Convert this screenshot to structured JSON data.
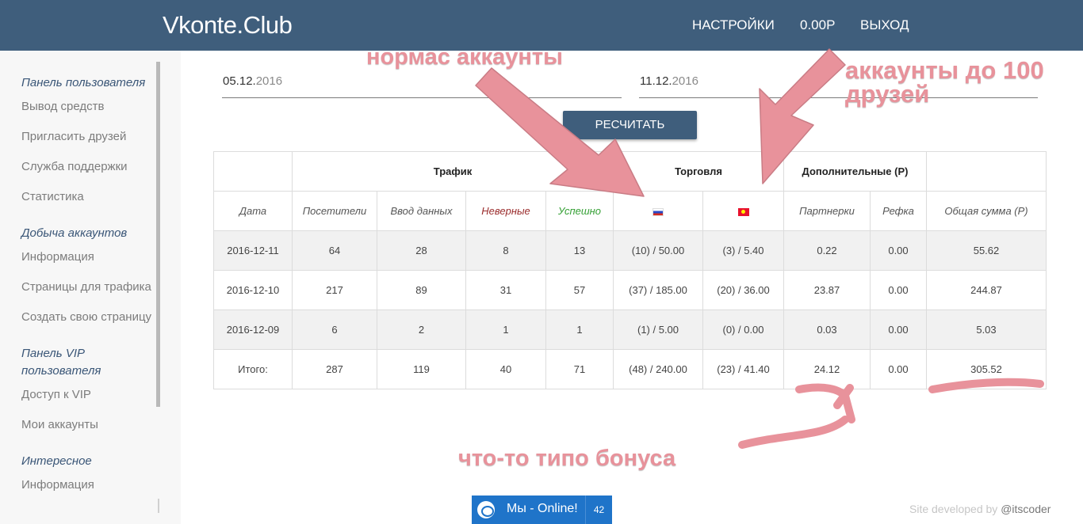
{
  "header": {
    "brand": "Vkonte.Club",
    "nav": {
      "settings": "НАСТРОЙКИ",
      "balance": "0.00Р",
      "exit": "ВЫХОД"
    }
  },
  "sidebar": {
    "sections": [
      {
        "title": "Панель пользователя",
        "items": [
          "Вывод средств",
          "Пригласить друзей",
          "Служба поддержки",
          "Статистика"
        ]
      },
      {
        "title": "Добыча аккаунтов",
        "items": [
          "Информация",
          "Страницы для трафика",
          "Создать свою страницу"
        ]
      },
      {
        "title_line1": "Панель VIP",
        "title_line2": "пользователя",
        "items": [
          "Доступ к VIP",
          "Мои аккаунты"
        ]
      },
      {
        "title": "Интересное",
        "items": [
          "Информация"
        ]
      }
    ]
  },
  "filters": {
    "date_from": {
      "day_month": "05.12.",
      "year": "2016"
    },
    "date_to": {
      "day_month": "11.12.",
      "year": "2016"
    },
    "recalc_label": "РЕСЧИТАТЬ"
  },
  "table": {
    "group_headers": {
      "traffic": "Трафик",
      "trade": "Торговля",
      "extra": "Дополнительные (Р)"
    },
    "columns": [
      "Дата",
      "Посетители",
      "Ввод данных",
      "Неверные",
      "Успешно",
      "ru-flag",
      "kg-flag",
      "Партнерки",
      "Рефка",
      "Общая сумма (Р)"
    ],
    "rows": [
      [
        "2016-12-11",
        "64",
        "28",
        "8",
        "13",
        "(10) / 50.00",
        "(3) / 5.40",
        "0.22",
        "0.00",
        "55.62"
      ],
      [
        "2016-12-10",
        "217",
        "89",
        "31",
        "57",
        "(37) / 185.00",
        "(20) / 36.00",
        "23.87",
        "0.00",
        "244.87"
      ],
      [
        "2016-12-09",
        "6",
        "2",
        "1",
        "1",
        "(1) / 5.00",
        "(0) / 0.00",
        "0.03",
        "0.00",
        "5.03"
      ],
      [
        "Итого:",
        "287",
        "119",
        "40",
        "71",
        "(48) / 240.00",
        "(23) / 41.40",
        "24.12",
        "0.00",
        "305.52"
      ]
    ],
    "colors": {
      "bad": "#9b2d2d",
      "ok": "#35a035"
    }
  },
  "annotations": {
    "note1": "нормас аккаунты",
    "note2_line1": "аккаунты до 100",
    "note2_line2": "друзей",
    "note3": "что-то типо бонуса",
    "color": "#e8929b"
  },
  "footer": {
    "chat_label": "Мы - Online!",
    "chat_count": "42",
    "credit_prefix": "Site developed by ",
    "credit_author": "@itscoder"
  }
}
